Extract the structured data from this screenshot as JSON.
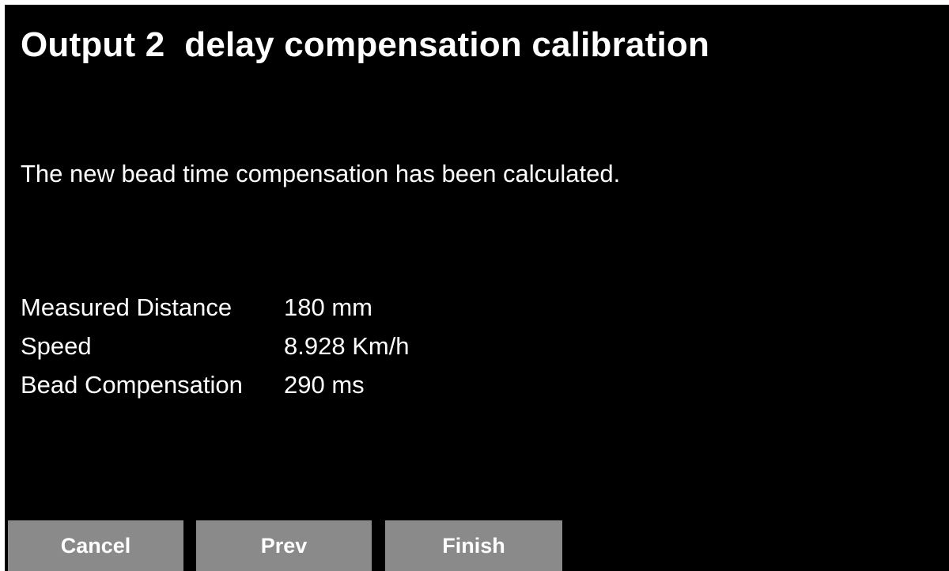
{
  "screen": {
    "title": "Output 2  delay compensation calibration",
    "message": "The new bead time compensation has been calculated."
  },
  "results": [
    {
      "label": "Measured Distance",
      "value": "180 mm"
    },
    {
      "label": "Speed",
      "value": "8.928 Km/h"
    },
    {
      "label": "Bead Compensation",
      "value": "290 ms"
    }
  ],
  "buttons": {
    "cancel": "Cancel",
    "prev": "Prev",
    "finish": "Finish"
  },
  "colors": {
    "background": "#000000",
    "text": "#ffffff",
    "button": "#8a8a8a"
  }
}
